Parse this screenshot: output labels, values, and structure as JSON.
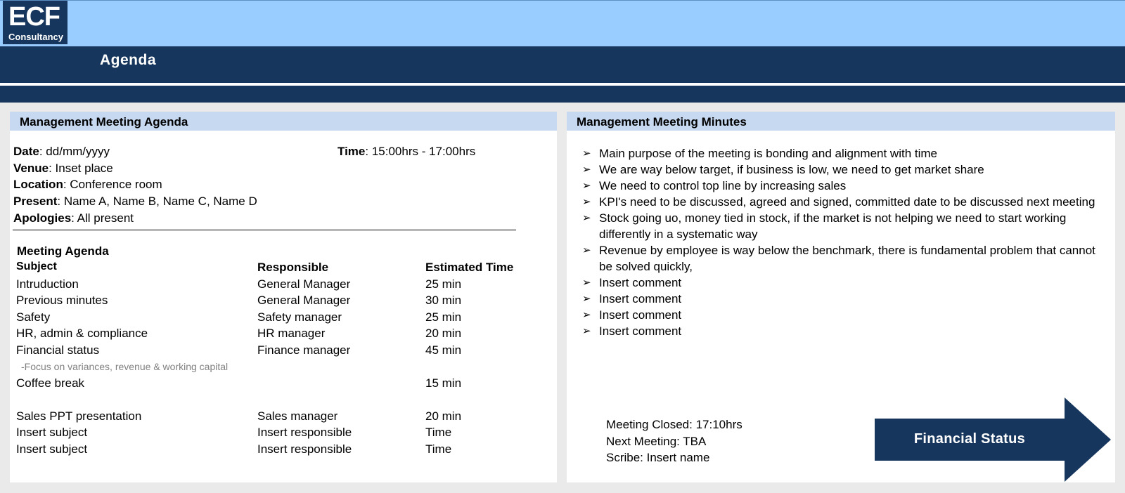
{
  "logo": {
    "main": "ECF",
    "sub": "Consultancy"
  },
  "page_title": "Agenda",
  "agenda": {
    "heading": "Management Meeting Agenda",
    "date_label": "Date",
    "date_value": ": dd/mm/yyyy",
    "time_label": "Time",
    "time_value": ": 15:00hrs - 17:00hrs",
    "venue_label": "Venue",
    "venue_value": ": Inset place",
    "location_label": "Location",
    "location_value": ": Conference room",
    "present_label": "Present",
    "present_value": ": Name A, Name B, Name C, Name D",
    "apologies_label": "Apologies",
    "apologies_value": ": All present",
    "section_title": "Meeting Agenda",
    "columns": [
      "Subject",
      "Responsible",
      "Estimated Time"
    ],
    "rows": [
      {
        "subject": "Intruduction",
        "responsible": "General Manager",
        "time": "25 min"
      },
      {
        "subject": "Previous minutes",
        "responsible": "General Manager",
        "time": "30 min"
      },
      {
        "subject": "Safety",
        "responsible": "Safety manager",
        "time": "25 min"
      },
      {
        "subject": "HR, admin & compliance",
        "responsible": "HR manager",
        "time": "20 min"
      },
      {
        "subject": "Financial status",
        "responsible": "Finance manager",
        "time": "45 min"
      },
      {
        "subject": "Coffee break",
        "responsible": "",
        "time": "15 min"
      },
      {
        "subject": "Sales PPT presentation",
        "responsible": "Sales manager",
        "time": "20 min"
      },
      {
        "subject": "Insert subject",
        "responsible": "Insert responsible",
        "time": "Time"
      },
      {
        "subject": "Insert subject",
        "responsible": "Insert responsible",
        "time": "Time"
      }
    ],
    "financial_note": "-Focus on variances, revenue & working capital"
  },
  "minutes": {
    "heading": "Management Meeting Minutes",
    "bullet_glyph": "➢",
    "items": [
      "Main purpose of the meeting is bonding and alignment with time",
      "We are way below target, if business is low, we need to get market share",
      "We need to control top line by increasing sales",
      "KPI's need to be discussed, agreed and signed, committed date to be discussed next meeting",
      "Stock going uo, money tied in stock, if the market is not helping we need to start working differently in a systematic way",
      "Revenue by employee is way below the benchmark, there is fundamental problem that cannot be solved quickly,",
      "Insert comment",
      "Insert comment",
      "Insert comment",
      "Insert comment"
    ],
    "meeting_closed": "Meeting Closed: 17:10hrs",
    "next_meeting": "Next Meeting: TBA",
    "scribe": "Scribe: Insert name"
  },
  "financial_status_button": "Financial  Status",
  "colors": {
    "navy": "#17365d",
    "sky": "#99ccff",
    "panel_header": "#c6d9f1",
    "canvas": "#eaeaea",
    "note_gray": "#808080"
  }
}
